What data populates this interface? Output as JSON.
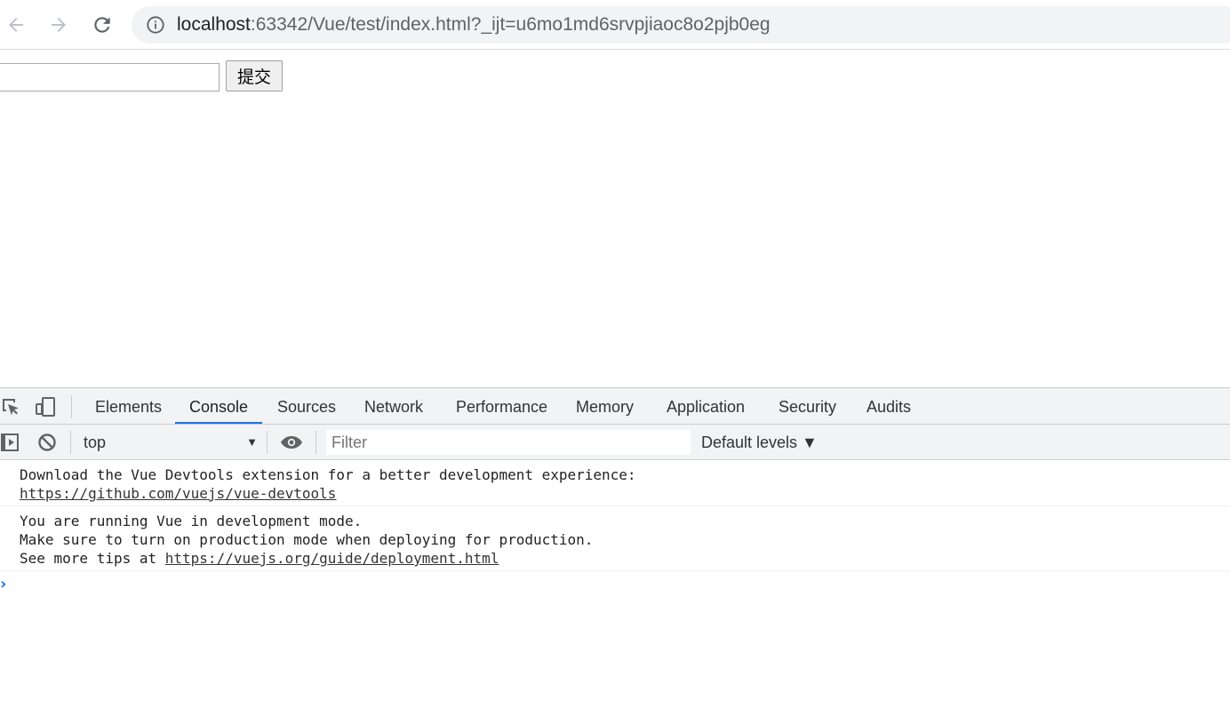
{
  "browser": {
    "url_host": "localhost",
    "url_rest": ":63342/Vue/test/index.html?_ijt=u6mo1md6srvpjiaoc8o2pjb0eg"
  },
  "page": {
    "input_value": "",
    "submit_label": "提交"
  },
  "devtools": {
    "tabs": [
      {
        "label": "Elements"
      },
      {
        "label": "Console",
        "active": true
      },
      {
        "label": "Sources"
      },
      {
        "label": "Network"
      },
      {
        "label": "Performance"
      },
      {
        "label": "Memory"
      },
      {
        "label": "Application"
      },
      {
        "label": "Security"
      },
      {
        "label": "Audits"
      }
    ],
    "context": "top",
    "filter_placeholder": "Filter",
    "levels_label": "Default levels ▼",
    "accent_color": "#1a73e8"
  },
  "console": {
    "messages": [
      {
        "line1": "Download the Vue Devtools extension for a better development experience:",
        "link": "https://github.com/vuejs/vue-devtools"
      },
      {
        "line1": "You are running Vue in development mode.",
        "line2": "Make sure to turn on production mode when deploying for production.",
        "line3_prefix": "See more tips at ",
        "link": "https://vuejs.org/guide/deployment.html"
      }
    ]
  }
}
